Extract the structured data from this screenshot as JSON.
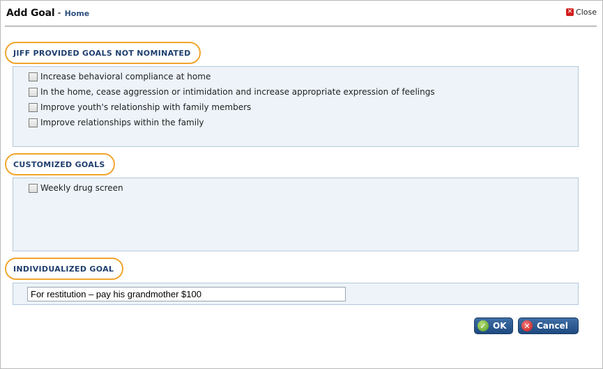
{
  "dialog": {
    "title": "Add Goal",
    "separator": "-",
    "subtitle": "Home",
    "close_label": "Close"
  },
  "sections": {
    "provided": {
      "title": "JIFF PROVIDED GOALS NOT NOMINATED",
      "items": [
        "Increase behavioral compliance at home",
        "In the home, cease aggression or intimidation and increase appropriate expression of feelings",
        "Improve youth's relationship with family members",
        "Improve relationships within the family"
      ]
    },
    "customized": {
      "title": "CUSTOMIZED GOALS",
      "items": [
        "Weekly drug screen"
      ]
    },
    "individualized": {
      "title": "INDIVIDUALIZED GOAL",
      "value": "For restitution – pay his grandmother $100"
    }
  },
  "buttons": {
    "ok_label": "OK",
    "cancel_label": "Cancel"
  },
  "icons": {
    "close": "close-x-icon",
    "ok": "checkmark-icon",
    "cancel": "cancel-x-icon"
  },
  "colors": {
    "highlight_ring": "#f0a52b",
    "section_title": "#1f3f6e",
    "panel_bg": "#edf3f9",
    "button_bg": "#2b5a92"
  }
}
